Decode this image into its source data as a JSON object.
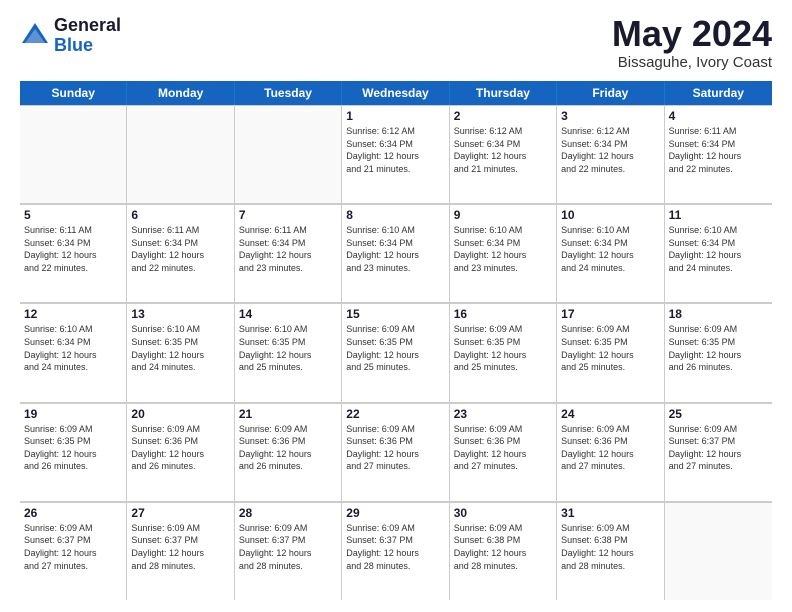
{
  "header": {
    "logo_general": "General",
    "logo_blue": "Blue",
    "month_title": "May 2024",
    "location": "Bissaguhe, Ivory Coast"
  },
  "days_of_week": [
    "Sunday",
    "Monday",
    "Tuesday",
    "Wednesday",
    "Thursday",
    "Friday",
    "Saturday"
  ],
  "weeks": [
    [
      {
        "day": "",
        "empty": true
      },
      {
        "day": "",
        "empty": true
      },
      {
        "day": "",
        "empty": true
      },
      {
        "day": "1",
        "lines": [
          "Sunrise: 6:12 AM",
          "Sunset: 6:34 PM",
          "Daylight: 12 hours",
          "and 21 minutes."
        ]
      },
      {
        "day": "2",
        "lines": [
          "Sunrise: 6:12 AM",
          "Sunset: 6:34 PM",
          "Daylight: 12 hours",
          "and 21 minutes."
        ]
      },
      {
        "day": "3",
        "lines": [
          "Sunrise: 6:12 AM",
          "Sunset: 6:34 PM",
          "Daylight: 12 hours",
          "and 22 minutes."
        ]
      },
      {
        "day": "4",
        "lines": [
          "Sunrise: 6:11 AM",
          "Sunset: 6:34 PM",
          "Daylight: 12 hours",
          "and 22 minutes."
        ]
      }
    ],
    [
      {
        "day": "5",
        "lines": [
          "Sunrise: 6:11 AM",
          "Sunset: 6:34 PM",
          "Daylight: 12 hours",
          "and 22 minutes."
        ]
      },
      {
        "day": "6",
        "lines": [
          "Sunrise: 6:11 AM",
          "Sunset: 6:34 PM",
          "Daylight: 12 hours",
          "and 22 minutes."
        ]
      },
      {
        "day": "7",
        "lines": [
          "Sunrise: 6:11 AM",
          "Sunset: 6:34 PM",
          "Daylight: 12 hours",
          "and 23 minutes."
        ]
      },
      {
        "day": "8",
        "lines": [
          "Sunrise: 6:10 AM",
          "Sunset: 6:34 PM",
          "Daylight: 12 hours",
          "and 23 minutes."
        ]
      },
      {
        "day": "9",
        "lines": [
          "Sunrise: 6:10 AM",
          "Sunset: 6:34 PM",
          "Daylight: 12 hours",
          "and 23 minutes."
        ]
      },
      {
        "day": "10",
        "lines": [
          "Sunrise: 6:10 AM",
          "Sunset: 6:34 PM",
          "Daylight: 12 hours",
          "and 24 minutes."
        ]
      },
      {
        "day": "11",
        "lines": [
          "Sunrise: 6:10 AM",
          "Sunset: 6:34 PM",
          "Daylight: 12 hours",
          "and 24 minutes."
        ]
      }
    ],
    [
      {
        "day": "12",
        "lines": [
          "Sunrise: 6:10 AM",
          "Sunset: 6:34 PM",
          "Daylight: 12 hours",
          "and 24 minutes."
        ]
      },
      {
        "day": "13",
        "lines": [
          "Sunrise: 6:10 AM",
          "Sunset: 6:35 PM",
          "Daylight: 12 hours",
          "and 24 minutes."
        ]
      },
      {
        "day": "14",
        "lines": [
          "Sunrise: 6:10 AM",
          "Sunset: 6:35 PM",
          "Daylight: 12 hours",
          "and 25 minutes."
        ]
      },
      {
        "day": "15",
        "lines": [
          "Sunrise: 6:09 AM",
          "Sunset: 6:35 PM",
          "Daylight: 12 hours",
          "and 25 minutes."
        ]
      },
      {
        "day": "16",
        "lines": [
          "Sunrise: 6:09 AM",
          "Sunset: 6:35 PM",
          "Daylight: 12 hours",
          "and 25 minutes."
        ]
      },
      {
        "day": "17",
        "lines": [
          "Sunrise: 6:09 AM",
          "Sunset: 6:35 PM",
          "Daylight: 12 hours",
          "and 25 minutes."
        ]
      },
      {
        "day": "18",
        "lines": [
          "Sunrise: 6:09 AM",
          "Sunset: 6:35 PM",
          "Daylight: 12 hours",
          "and 26 minutes."
        ]
      }
    ],
    [
      {
        "day": "19",
        "lines": [
          "Sunrise: 6:09 AM",
          "Sunset: 6:35 PM",
          "Daylight: 12 hours",
          "and 26 minutes."
        ]
      },
      {
        "day": "20",
        "lines": [
          "Sunrise: 6:09 AM",
          "Sunset: 6:36 PM",
          "Daylight: 12 hours",
          "and 26 minutes."
        ]
      },
      {
        "day": "21",
        "lines": [
          "Sunrise: 6:09 AM",
          "Sunset: 6:36 PM",
          "Daylight: 12 hours",
          "and 26 minutes."
        ]
      },
      {
        "day": "22",
        "lines": [
          "Sunrise: 6:09 AM",
          "Sunset: 6:36 PM",
          "Daylight: 12 hours",
          "and 27 minutes."
        ]
      },
      {
        "day": "23",
        "lines": [
          "Sunrise: 6:09 AM",
          "Sunset: 6:36 PM",
          "Daylight: 12 hours",
          "and 27 minutes."
        ]
      },
      {
        "day": "24",
        "lines": [
          "Sunrise: 6:09 AM",
          "Sunset: 6:36 PM",
          "Daylight: 12 hours",
          "and 27 minutes."
        ]
      },
      {
        "day": "25",
        "lines": [
          "Sunrise: 6:09 AM",
          "Sunset: 6:37 PM",
          "Daylight: 12 hours",
          "and 27 minutes."
        ]
      }
    ],
    [
      {
        "day": "26",
        "lines": [
          "Sunrise: 6:09 AM",
          "Sunset: 6:37 PM",
          "Daylight: 12 hours",
          "and 27 minutes."
        ]
      },
      {
        "day": "27",
        "lines": [
          "Sunrise: 6:09 AM",
          "Sunset: 6:37 PM",
          "Daylight: 12 hours",
          "and 28 minutes."
        ]
      },
      {
        "day": "28",
        "lines": [
          "Sunrise: 6:09 AM",
          "Sunset: 6:37 PM",
          "Daylight: 12 hours",
          "and 28 minutes."
        ]
      },
      {
        "day": "29",
        "lines": [
          "Sunrise: 6:09 AM",
          "Sunset: 6:37 PM",
          "Daylight: 12 hours",
          "and 28 minutes."
        ]
      },
      {
        "day": "30",
        "lines": [
          "Sunrise: 6:09 AM",
          "Sunset: 6:38 PM",
          "Daylight: 12 hours",
          "and 28 minutes."
        ]
      },
      {
        "day": "31",
        "lines": [
          "Sunrise: 6:09 AM",
          "Sunset: 6:38 PM",
          "Daylight: 12 hours",
          "and 28 minutes."
        ]
      },
      {
        "day": "",
        "empty": true
      }
    ]
  ]
}
